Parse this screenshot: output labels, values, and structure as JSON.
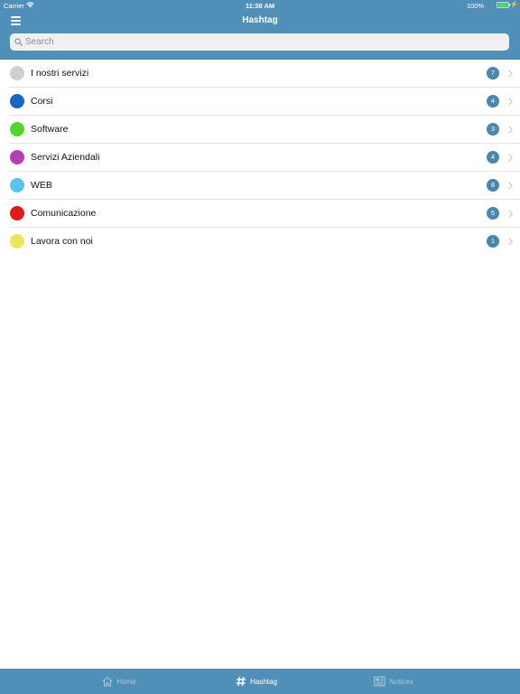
{
  "status_bar": {
    "carrier": "Carrier",
    "time": "11:38 AM",
    "battery": "100%"
  },
  "nav": {
    "title": "Hashtag",
    "menu_icon": "hamburger-icon"
  },
  "search": {
    "placeholder": "Search",
    "value": "",
    "icon": "search-icon"
  },
  "hashtags": [
    {
      "label": "I nostri servizi",
      "count": "7",
      "color": "#cfcfcf"
    },
    {
      "label": "Corsi",
      "count": "4",
      "color": "#1a63c7"
    },
    {
      "label": "Software",
      "count": "3",
      "color": "#55d42b"
    },
    {
      "label": "Servizi Aziendali",
      "count": "4",
      "color": "#b43fb8"
    },
    {
      "label": "WEB",
      "count": "8",
      "color": "#5bc3ef"
    },
    {
      "label": "Comunicazione",
      "count": "5",
      "color": "#e11a1a"
    },
    {
      "label": "Lavora con noi",
      "count": "1",
      "color": "#ece45c"
    }
  ],
  "tab_bar": {
    "tabs": [
      {
        "label": "Home",
        "icon": "home-icon",
        "active": false
      },
      {
        "label": "Hashtag",
        "icon": "hashtag-icon",
        "active": true
      },
      {
        "label": "Notices",
        "icon": "newspaper-icon",
        "active": false
      }
    ]
  },
  "colors": {
    "bar": "#5090b8",
    "badge": "#4a87ad",
    "tab_active": "#ffffff",
    "tab_inactive": "#a9c7da"
  }
}
